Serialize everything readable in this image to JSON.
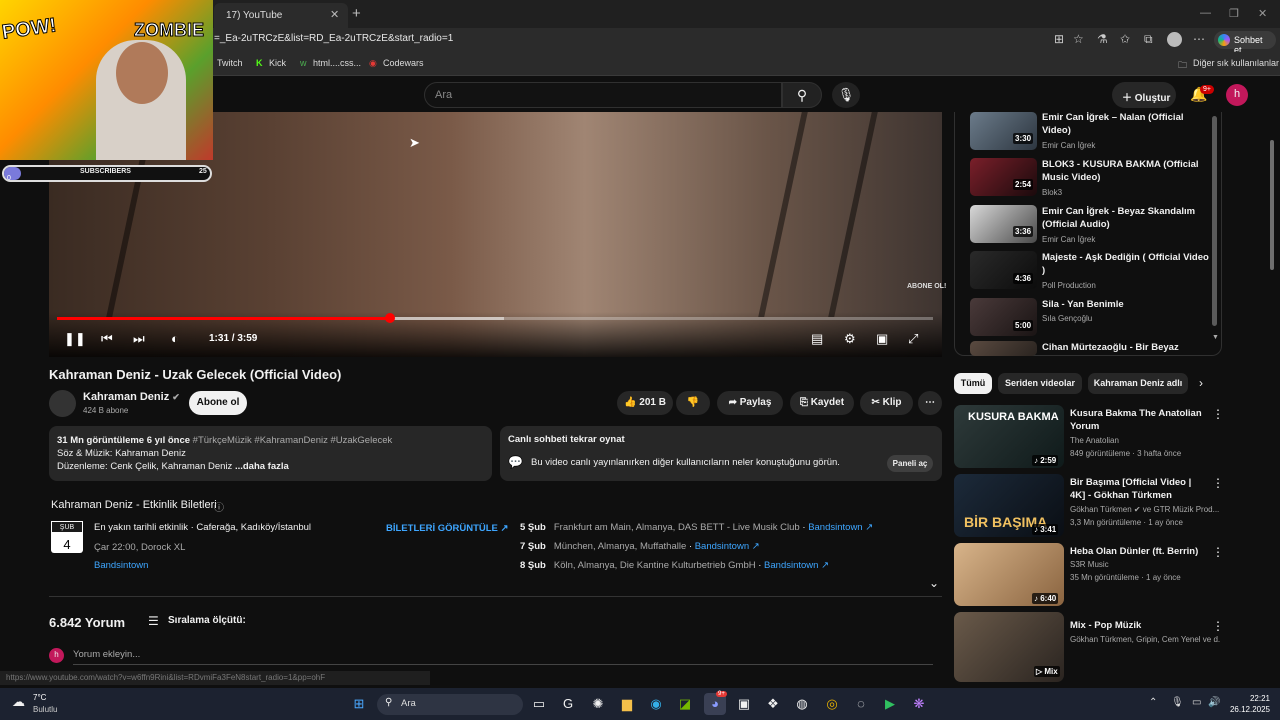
{
  "browser": {
    "tab_title": "17) YouTube",
    "url": "=_Ea-2uTRCzE&list=RD_Ea-2uTRCzE&start_radio=1",
    "copilot_label": "Sohbet et",
    "bookmarks": [
      "Twitch",
      "Kick",
      "html....css...",
      "Codewars"
    ],
    "other_bookmarks": "Diğer sık kullanılanlar",
    "status_url": "https://www.youtube.com/watch?v=w6ffn9Rini&list=RDvmiFa3FeN8start_radio=1&pp=ohF"
  },
  "header": {
    "search_placeholder": "Ara",
    "create_label": "Oluştur",
    "notif_count": "9+",
    "user_initial": "h"
  },
  "overlay": {
    "pow_text": "POW!",
    "zombie_text": "ZOMBIE",
    "bar_label": "SUBSCRIBERS",
    "bar_dot": "0",
    "bar_count": "25"
  },
  "player": {
    "time": "1:31 / 3:59",
    "progress_fraction": 0.38,
    "buffered_fraction": 0.51,
    "watermark": "ABONE OL!"
  },
  "video": {
    "title": "Kahraman Deniz - Uzak Gelecek (Official Video)",
    "channel": "Kahraman Deniz",
    "subscribers": "424 B abone",
    "subscribe_label": "Abone ol",
    "likes": "201 B",
    "share_label": "Paylaş",
    "save_label": "Kaydet",
    "clip_label": "Klip"
  },
  "description": {
    "views": "31 Mn görüntüleme  6 yıl önce",
    "tags": "#TürkçeMüzik #KahramanDeniz #UzakGelecek",
    "line2": "Söz & Müzik: Kahraman Deniz",
    "line3": "Düzenleme: Cenk Çelik, Kahraman Deniz",
    "more": "...daha fazla"
  },
  "live_chat": {
    "title": "Canlı sohbeti tekrar oynat",
    "text": "Bu video canlı yayınlanırken diğer kullanıcıların neler konuştuğunu görün.",
    "button": "Paneli aç"
  },
  "events": {
    "title": "Kahraman Deniz - Etkinlik Biletleri",
    "cal_month": "ŞUB",
    "cal_day": "4",
    "main_text": "En yakın tarihli etkinlik · Caferağa, Kadıköy/İstanbul",
    "time_text": "Çar 22:00, Dorock XL",
    "bandsintown": "Bandsintown",
    "tickets_label": "BİLETLERİ GÖRÜNTÜLE ↗",
    "rows": [
      {
        "date": "5 Şub",
        "place": "Frankfurt am Main, Almanya, DAS BETT - Live Musik Club",
        "src": "Bandsintown ↗"
      },
      {
        "date": "7 Şub",
        "place": "München, Almanya, Muffathalle",
        "src": "Bandsintown ↗"
      },
      {
        "date": "8 Şub",
        "place": "Köln, Almanya, Die Kantine Kulturbetrieb GmbH",
        "src": "Bandsintown ↗"
      }
    ]
  },
  "comments": {
    "count": "6.842 Yorum",
    "sort_label": "Sıralama ölçütü:",
    "placeholder": "Yorum ekleyin...",
    "user_initial": "h"
  },
  "playlist": [
    {
      "title": "Emir Can İğrek – Nalan (Official Video)",
      "channel": "Emir Can İğrek",
      "duration": "3:30"
    },
    {
      "title": "BLOK3 - KUSURA BAKMA (Official Music Video)",
      "channel": "Blok3",
      "duration": "2:54"
    },
    {
      "title": "Emir Can İğrek - Beyaz Skandalım (Official Audio)",
      "channel": "Emir Can İğrek",
      "duration": "3:36"
    },
    {
      "title": "Majeste - Aşk Dediğin ( Official Video )",
      "channel": "Poll Production",
      "duration": "4:36"
    },
    {
      "title": "Sila - Yan Benimle",
      "channel": "Sıla Gençoğlu",
      "duration": "5:00"
    },
    {
      "title": "Cihan Mürtezaoğlu - Bir Beyaz",
      "channel": "",
      "duration": ""
    }
  ],
  "chips": [
    "Tümü",
    "Seriden videolar",
    "Kahraman Deniz adlı"
  ],
  "recommendations": [
    {
      "title": "Kusura Bakma  The Anatolian Yorum",
      "channel": "The Anatolian",
      "meta": "849 görüntüleme · 3 hafta önce",
      "duration": "♪ 2:59",
      "thumb_text": "KUSURA BAKMA"
    },
    {
      "title": "Bir Başıma [Official Video | 4K] - Gökhan Türkmen",
      "channel": "Gökhan Türkmen ✔ ve GTR Müzik Prod...",
      "meta": "3,3 Mn görüntüleme · 1 ay önce",
      "duration": "♪ 3:41",
      "thumb_text": "BİR BAŞIMA"
    },
    {
      "title": "Heba Olan Dünler (ft. Berrin)",
      "channel": "S3R Music",
      "meta": "35 Mn görüntüleme · 1 ay önce",
      "duration": "♪ 6:40",
      "thumb_text": ""
    },
    {
      "title": "Mix - Pop Müzik",
      "channel": "Gökhan Türkmen, Gripin, Cem Yenel ve d...",
      "meta": "",
      "duration": "▷ Mix",
      "thumb_text": ""
    }
  ],
  "taskbar": {
    "temp": "7°C",
    "condition": "Bulutlu",
    "search": "Ara",
    "time": "22:21",
    "date": "26.12.2025",
    "discord_badge": "9+"
  }
}
